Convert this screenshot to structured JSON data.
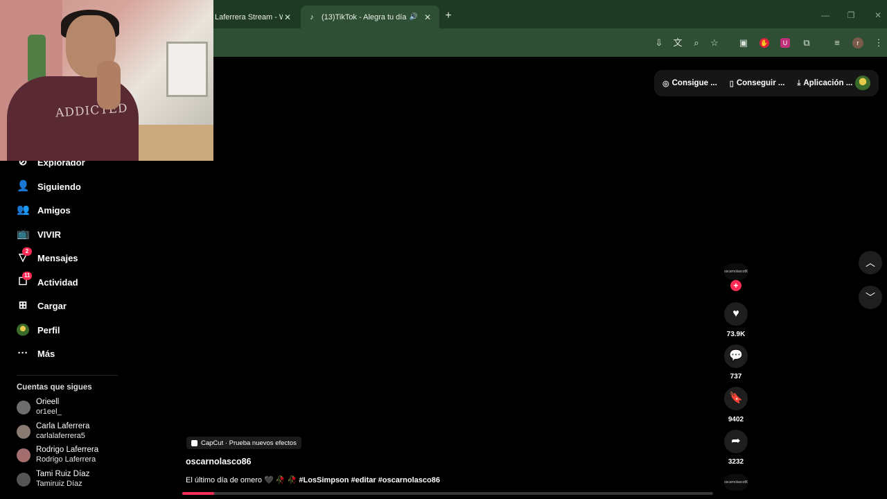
{
  "browser": {
    "tabs": [
      {
        "title": "Laferrera Stream - Watch",
        "icon": "stream-favicon",
        "active": false
      },
      {
        "title": "(13)TikTok - Alegra tu día",
        "icon": "tiktok-favicon",
        "active": true,
        "audio": true
      }
    ],
    "new_tab": "+",
    "toolbar_icons": [
      "install-icon",
      "translate-icon",
      "zoom-icon",
      "star-icon",
      "extension-box-icon",
      "adblock-icon",
      "ublock-icon",
      "extensions-icon",
      "media-icon",
      "profile-avatar",
      "menu-icon"
    ],
    "profile_initial": "r"
  },
  "top_bar": {
    "items": [
      {
        "label": "Consigue ...",
        "icon": "coin-icon"
      },
      {
        "label": "Conseguir ...",
        "icon": "phone-icon"
      },
      {
        "label": "Aplicación ...",
        "icon": "download-icon"
      }
    ]
  },
  "sidebar": {
    "items": [
      {
        "label": "Explorador",
        "icon": "compass-icon"
      },
      {
        "label": "Siguiendo",
        "icon": "person-follow-icon"
      },
      {
        "label": "Amigos",
        "icon": "friends-icon"
      },
      {
        "label": "VIVIR",
        "icon": "live-tv-icon"
      },
      {
        "label": "Mensajes",
        "icon": "send-icon",
        "badge": "2"
      },
      {
        "label": "Actividad",
        "icon": "inbox-icon",
        "badge": "11"
      },
      {
        "label": "Cargar",
        "icon": "upload-plus-icon"
      },
      {
        "label": "Perfil",
        "icon": "profile-avatar"
      },
      {
        "label": "Más",
        "icon": "more-dots-icon"
      }
    ],
    "following_heading": "Cuentas que sigues",
    "accounts": [
      {
        "name": "Orieell",
        "handle": "or1eel_"
      },
      {
        "name": "Carla Laferrera",
        "handle": "carlalaferrera5"
      },
      {
        "name": "Rodrigo Laferrera",
        "handle": "Rodrigo Laferrera"
      },
      {
        "name": "Tami Ruiz Díaz",
        "handle": "Tamiruiz Díaz"
      }
    ]
  },
  "video": {
    "capcut_label": "CapCut · Prueba nuevos efectos",
    "author": "oscarnolasco86",
    "description_text": "El último día de omero 🖤 🥀 🥀 ",
    "hashtags": "#LosSimpson #editar #oscarnolasco86",
    "progress_fraction": 0.06,
    "creator_tag": "oscarnolasco86"
  },
  "actions": {
    "likes": "73.9K",
    "comments": "737",
    "saves": "9402",
    "shares": "3232",
    "follow_plus": "+"
  },
  "webcam": {
    "shirt_text": "ADDICTED"
  },
  "colors": {
    "accent": "#fe2c55",
    "chrome_bg": "#1f3a24",
    "toolbar_bg": "#2e4f34"
  }
}
